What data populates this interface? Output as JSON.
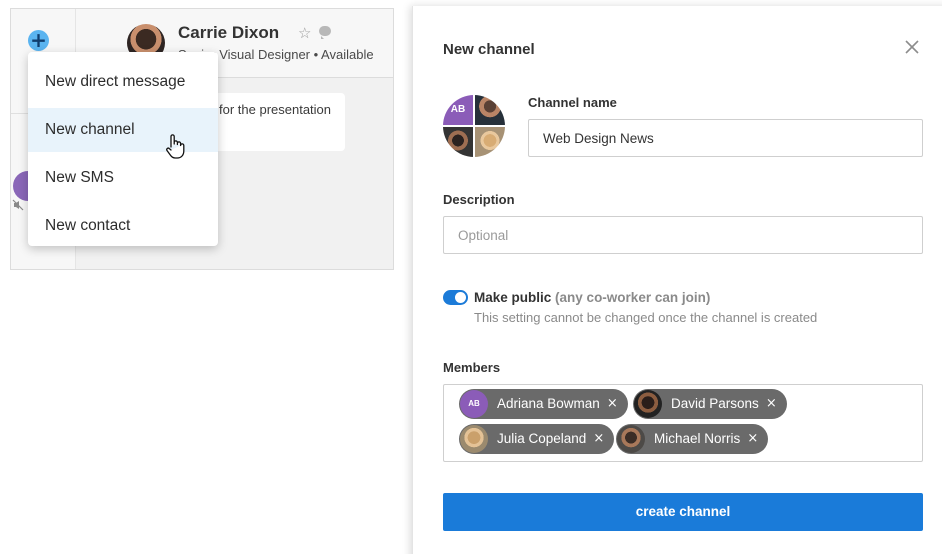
{
  "chat": {
    "contact_name": "Carrie Dixon",
    "contact_status": "Senior Visual Designer • Available",
    "message_preview": "for the presentation",
    "icons": {
      "add": "plus-icon",
      "favorite": "star-icon",
      "chat": "chat-bubble-icon",
      "muted": "mute-icon"
    }
  },
  "menu": {
    "items": [
      {
        "label": "New direct message"
      },
      {
        "label": "New channel"
      },
      {
        "label": "New SMS"
      },
      {
        "label": "New contact"
      }
    ],
    "active_item": "New channel"
  },
  "dialog": {
    "title": "New channel",
    "group_avatar_initials": "AB",
    "channel_name_label": "Channel name",
    "channel_name_value": "Web Design News",
    "description_label": "Description",
    "description_placeholder": "Optional",
    "public_toggle": {
      "on": true,
      "label": "Make public",
      "hint": "(any co-worker can join)"
    },
    "public_note": "This setting cannot be changed once the channel is created",
    "members_label": "Members",
    "members": [
      {
        "name": "Adriana Bowman",
        "initials": "AB"
      },
      {
        "name": "David Parsons"
      },
      {
        "name": "Julia Copeland"
      },
      {
        "name": "Michael Norris"
      }
    ],
    "remove_glyph": "×",
    "create_button": "create channel"
  },
  "colors": {
    "accent": "#1a7bd9",
    "chip": "#6a6a6a",
    "avatar_purple": "#8b5cb8",
    "online": "#35b35a"
  }
}
